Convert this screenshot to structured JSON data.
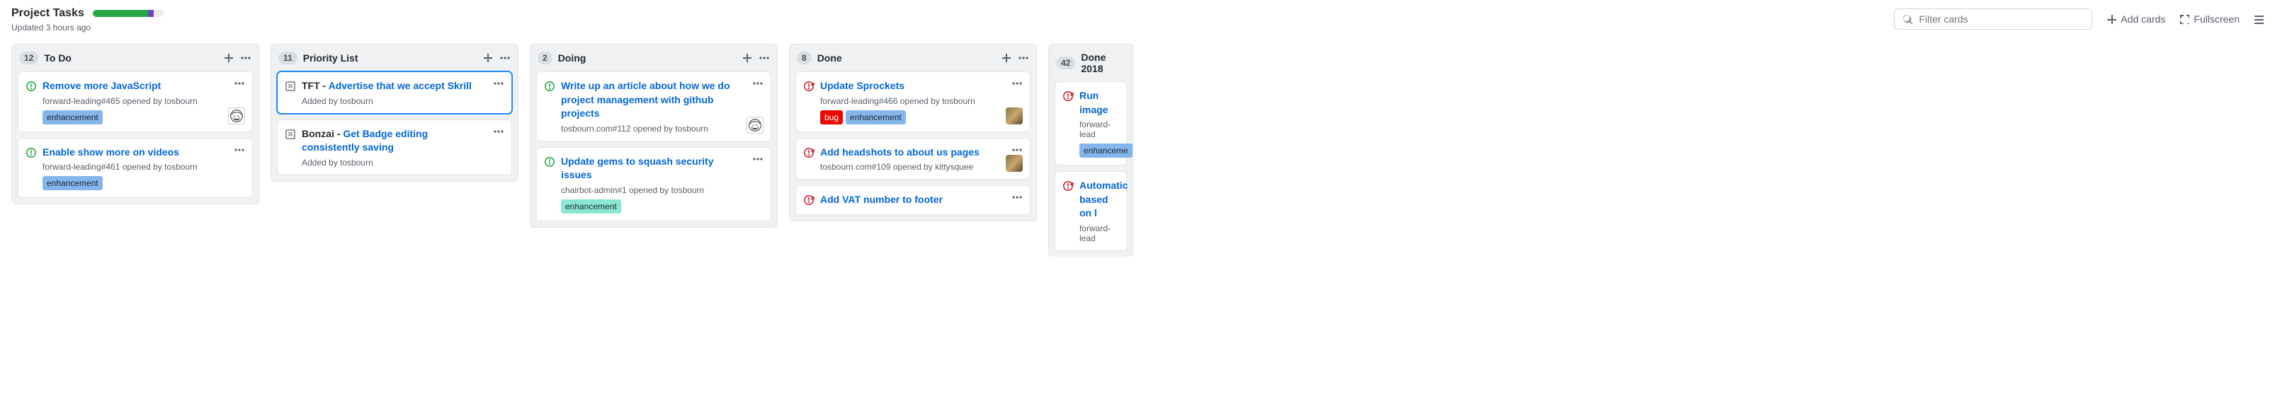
{
  "header": {
    "title": "Project Tasks",
    "updated": "Updated 3 hours ago",
    "progress": {
      "green_pct": 78,
      "purple_pct": 8
    }
  },
  "toolbar": {
    "filter_placeholder": "Filter cards",
    "add_cards": "Add cards",
    "fullscreen": "Fullscreen"
  },
  "columns": [
    {
      "count": 12,
      "title": "To Do",
      "cards": [
        {
          "icon": "issue-open",
          "title_link": "Remove more JavaScript",
          "meta_prefix": "forward-leading#465 opened by ",
          "meta_user": "tosbourn",
          "labels": [
            {
              "text": "enhancement",
              "cls": "lbl-enh-blue"
            }
          ],
          "avatar": "sketched"
        },
        {
          "icon": "issue-open",
          "title_link": "Enable show more on videos",
          "meta_prefix": "forward-leading#461 opened by ",
          "meta_user": "tosbourn",
          "labels": [
            {
              "text": "enhancement",
              "cls": "lbl-enh-blue"
            }
          ]
        }
      ]
    },
    {
      "count": 11,
      "title": "Priority List",
      "cards": [
        {
          "icon": "note",
          "selected": true,
          "title_prefix": "TFT - ",
          "title_link": "Advertise that we accept Skrill",
          "meta_prefix": "Added by ",
          "meta_user": "tosbourn"
        },
        {
          "icon": "note",
          "title_prefix": "Bonzai - ",
          "title_link": "Get Badge editing consistently saving",
          "meta_prefix": "Added by ",
          "meta_user": "tosbourn"
        }
      ]
    },
    {
      "count": 2,
      "title": "Doing",
      "cards": [
        {
          "icon": "issue-open",
          "title_link": "Write up an article about how we do project management with github projects",
          "meta_prefix": "tosbourn.com#112 opened by ",
          "meta_user": "tosbourn",
          "avatar": "sketched"
        },
        {
          "icon": "issue-open",
          "title_link": "Update gems to squash security issues",
          "meta_prefix": "chairbot-admin#1 opened by ",
          "meta_user": "tosbourn",
          "labels": [
            {
              "text": "enhancement",
              "cls": "lbl-enh-teal"
            }
          ],
          "cutbottom": true
        }
      ]
    },
    {
      "count": 8,
      "title": "Done",
      "cards": [
        {
          "icon": "issue-closed",
          "title_link": "Update Sprockets",
          "meta_prefix": "forward-leading#466 opened by ",
          "meta_user": "tosbourn",
          "labels": [
            {
              "text": "bug",
              "cls": "lbl-bug"
            },
            {
              "text": "enhancement",
              "cls": "lbl-enh-blue"
            }
          ],
          "avatar": "photo"
        },
        {
          "icon": "issue-closed",
          "title_link": "Add headshots to about us pages",
          "meta_prefix": "tosbourn.com#109 opened by ",
          "meta_user": "kittysquee",
          "avatar": "photo"
        },
        {
          "icon": "issue-closed",
          "title_link": "Add VAT number to footer",
          "cutbottom": true
        }
      ]
    },
    {
      "count": 42,
      "title": "Done 2018",
      "truncated": true,
      "cards": [
        {
          "icon": "issue-closed",
          "title_link": "Run image",
          "meta_prefix": "forward-lead",
          "labels": [
            {
              "text": "enhanceme",
              "cls": "lbl-enh-blue"
            }
          ]
        },
        {
          "icon": "issue-closed",
          "title_link": "Automatic",
          "title_link2": "based on l",
          "meta_prefix": "forward-lead",
          "cutbottom": true
        }
      ]
    }
  ]
}
